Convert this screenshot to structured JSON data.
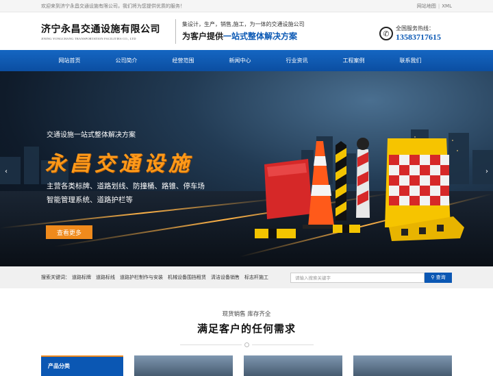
{
  "topbar": {
    "welcome": "欢迎来到济宁永昌交通设施有限公司，我们将为您提供优质的服务！",
    "links": [
      "网站地图",
      "XML"
    ]
  },
  "header": {
    "company_cn": "济宁永昌交通设施有限公司",
    "company_en": "JINING YONGCHANG TRANSPORTATION FACILITIES CO., LTD",
    "slogan_line1": "集设计，生产，销售,施工，为一体的交通设施公司",
    "slogan_line2_prefix": "为客户提供",
    "slogan_line2_highlight": "一站式整体解决方案",
    "hotline_label": "全国服务热线：",
    "hotline_number": "13583717615",
    "phone_icon": "phone-icon"
  },
  "nav": {
    "items": [
      "网站首页",
      "公司简介",
      "经营范围",
      "新闻中心",
      "行业资讯",
      "工程案例",
      "联系我们"
    ]
  },
  "banner": {
    "subtitle": "交通设施一站式整体解决方案",
    "title": "永昌交通设施",
    "line1": "主营各类标牌、道路划线、防撞桶、路锥、停车场",
    "line2": "智能管理系统、道路护栏等",
    "button": "查看更多",
    "prev": "‹",
    "next": "›"
  },
  "search": {
    "label": "搜索关键词：",
    "keywords": [
      "道路标牌",
      "道路标线",
      "道路护栏制作与安装",
      "机械设备围挡租赁",
      "清洁设备销售",
      "标志杆施工"
    ],
    "placeholder": "请输入搜索关键字",
    "button": "查询"
  },
  "section": {
    "subtitle": "现货销售 库存齐全",
    "title": "满足客户的任何需求"
  },
  "category": {
    "title": "产品分类"
  },
  "colors": {
    "brand_blue": "#0b57b3",
    "accent_orange": "#f08a1c"
  }
}
